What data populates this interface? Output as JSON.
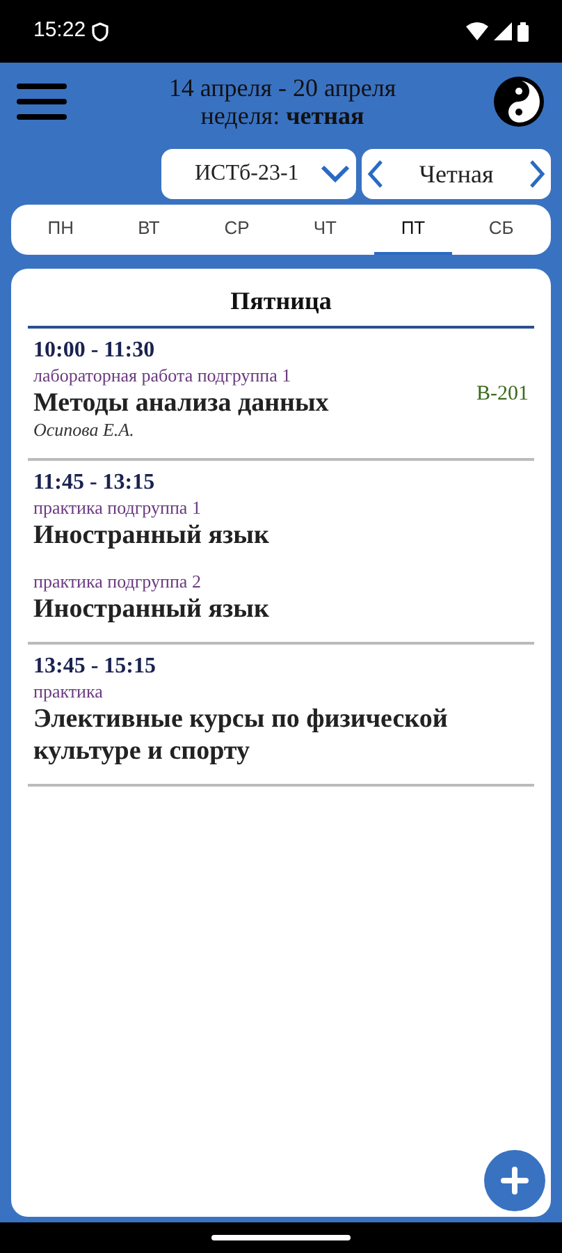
{
  "status_bar": {
    "time": "15:22"
  },
  "header": {
    "date_range": "14 апреля - 20 апреля",
    "week_label": "неделя: **четная**"
  },
  "group_select": {
    "value": "ИСТб-23-1"
  },
  "week_select": {
    "value": "Четная"
  },
  "day_tabs": [
    {
      "label": "ПН",
      "selected": false
    },
    {
      "label": "ВТ",
      "selected": false
    },
    {
      "label": "СР",
      "selected": false
    },
    {
      "label": "ЧТ",
      "selected": false
    },
    {
      "label": "ПТ",
      "selected": true
    },
    {
      "label": "СБ",
      "selected": false
    }
  ],
  "day": {
    "title": "Пятница",
    "lessons": [
      {
        "time": "10:00 - 11:30",
        "entries": [
          {
            "type": "лабораторная работа подгруппа 1",
            "subject": "Методы анализа данных",
            "teacher": "Осипова Е.А.",
            "room": "В-201"
          }
        ]
      },
      {
        "time": "11:45 - 13:15",
        "entries": [
          {
            "type": "практика подгруппа 1",
            "subject": "Иностранный язык"
          },
          {
            "type": "практика подгруппа 2",
            "subject": "Иностранный язык"
          }
        ]
      },
      {
        "time": "13:45 - 15:15",
        "entries": [
          {
            "type": "практика",
            "subject": "Элективные курсы по физической культуре и спорту"
          }
        ]
      }
    ]
  }
}
